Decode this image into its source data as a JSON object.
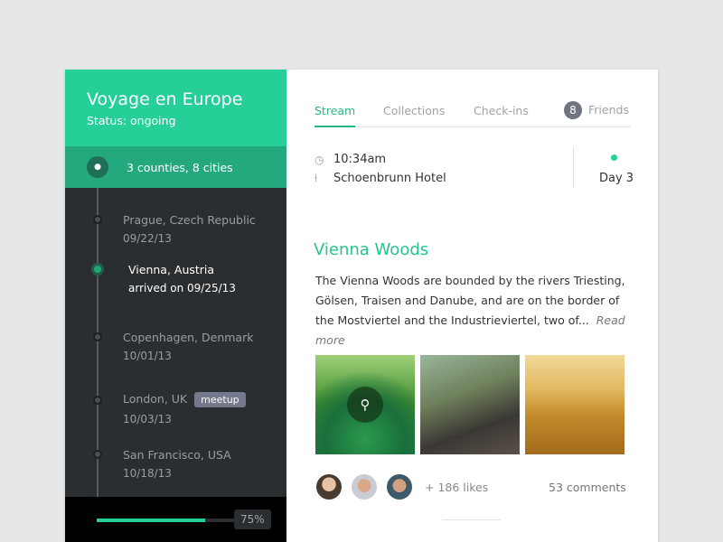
{
  "sidebar": {
    "title": "Voyage en Europe",
    "status": "Status: ongoing",
    "summary": "3 counties, 8 cities",
    "stops": [
      {
        "place": "Prague, Czech Republic",
        "date": "09/22/13"
      },
      {
        "place": "Vienna, Austria",
        "date": "arrived on 09/25/13",
        "active": true
      },
      {
        "place": "Copenhagen, Denmark",
        "date": "10/01/13"
      },
      {
        "place": "London, UK",
        "date": "10/03/13",
        "tag": "meetup"
      },
      {
        "place": "San Francisco, USA",
        "date": "10/18/13"
      }
    ],
    "progress": {
      "value": 75,
      "label": "75%"
    }
  },
  "tabs": [
    {
      "label": "Stream",
      "active": true
    },
    {
      "label": "Collections"
    },
    {
      "label": "Check-ins"
    },
    {
      "label": "Friends",
      "badge": "8"
    }
  ],
  "entry": {
    "time": "10:34am",
    "location": "Schoenbrunn Hotel",
    "day": "Day 3",
    "title": "Vienna Woods",
    "description": "The Vienna Woods are bounded by the rivers Triesting, Gölsen, Traisen and Danube, and are on the border of the Mostviertel and the Industrieviertel, two of...",
    "read_more": "Read more",
    "likes": "+ 186 likes",
    "comments": "53 comments"
  },
  "colors": {
    "accent": "#26cf97",
    "sidebar": "#2b2e30"
  }
}
